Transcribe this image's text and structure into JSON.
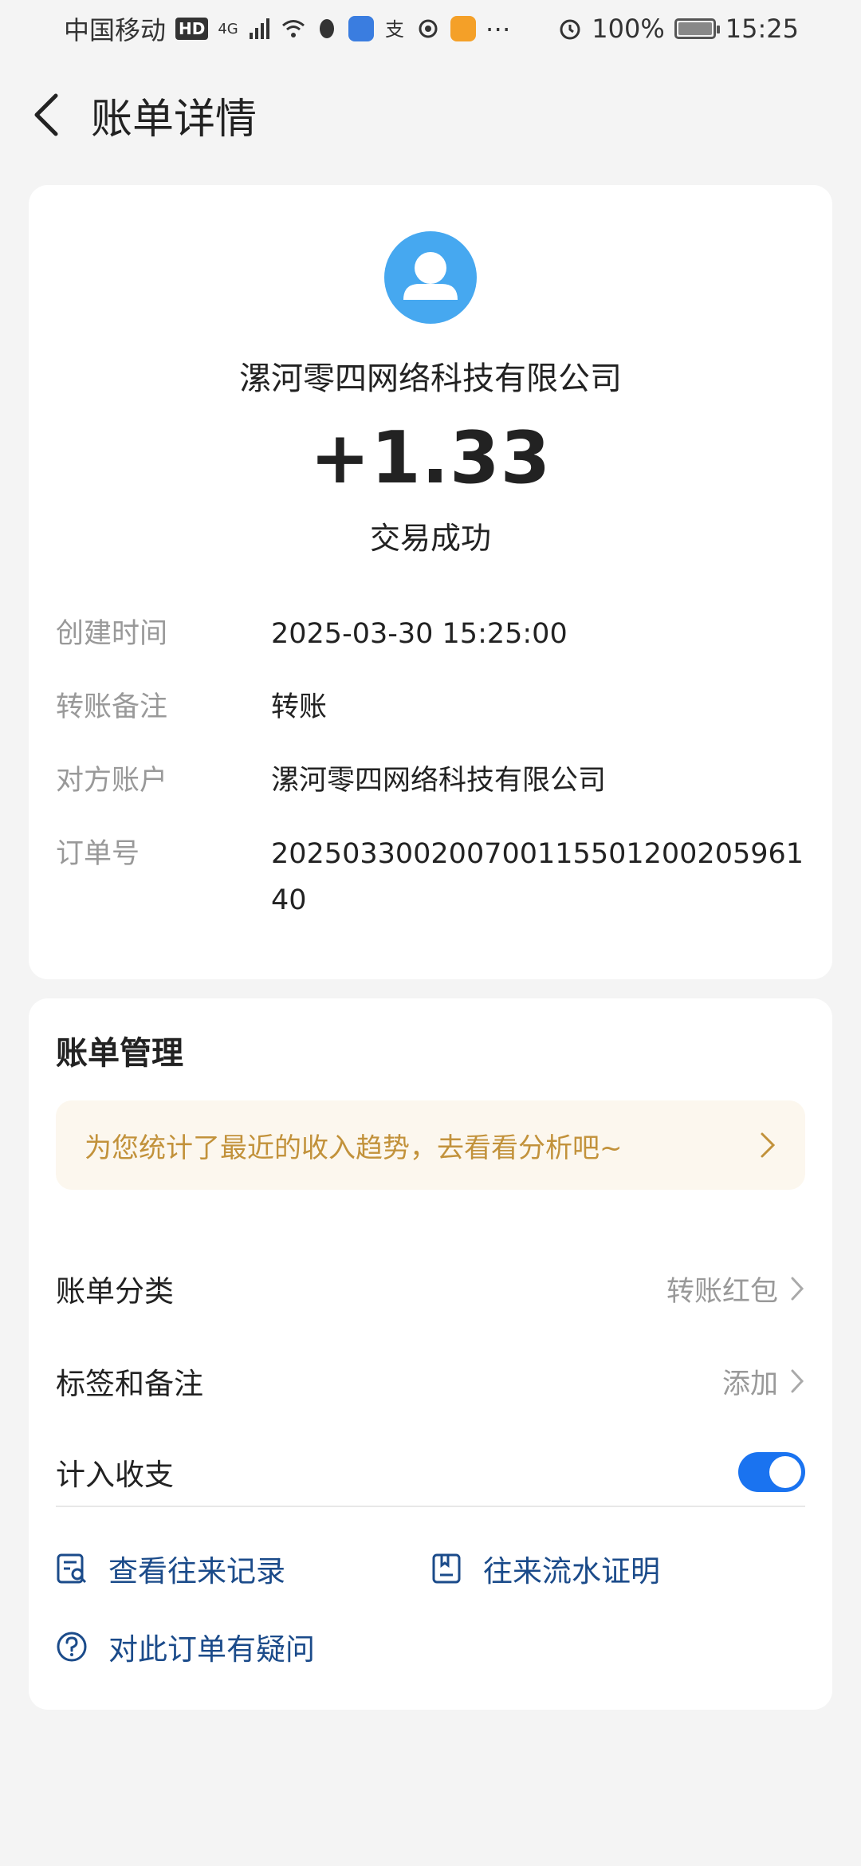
{
  "statusbar": {
    "carrier": "中国移动",
    "hd": "HD",
    "net": "4G",
    "battery": "100%",
    "time": "15:25"
  },
  "header": {
    "title": "账单详情"
  },
  "transaction": {
    "payee": "漯河零四网络科技有限公司",
    "amount": "+1.33",
    "status": "交易成功",
    "details": [
      {
        "label": "创建时间",
        "value": "2025-03-30 15:25:00"
      },
      {
        "label": "转账备注",
        "value": "转账"
      },
      {
        "label": "对方账户",
        "value": "漯河零四网络科技有限公司"
      },
      {
        "label": "订单号",
        "value": "20250330020070011550120020596140"
      }
    ]
  },
  "management": {
    "title": "账单管理",
    "banner": "为您统计了最近的收入趋势，去看看分析吧~",
    "category_label": "账单分类",
    "category_value": "转账红包",
    "tags_label": "标签和备注",
    "tags_value": "添加",
    "include_label": "计入收支",
    "include_on": true,
    "link_records": "查看往来记录",
    "link_proof": "往来流水证明",
    "link_question": "对此订单有疑问"
  },
  "colors": {
    "accent": "#1a73f0",
    "avatar": "#46a8f0",
    "banner_text": "#c2923b",
    "link": "#1b4b8a"
  }
}
